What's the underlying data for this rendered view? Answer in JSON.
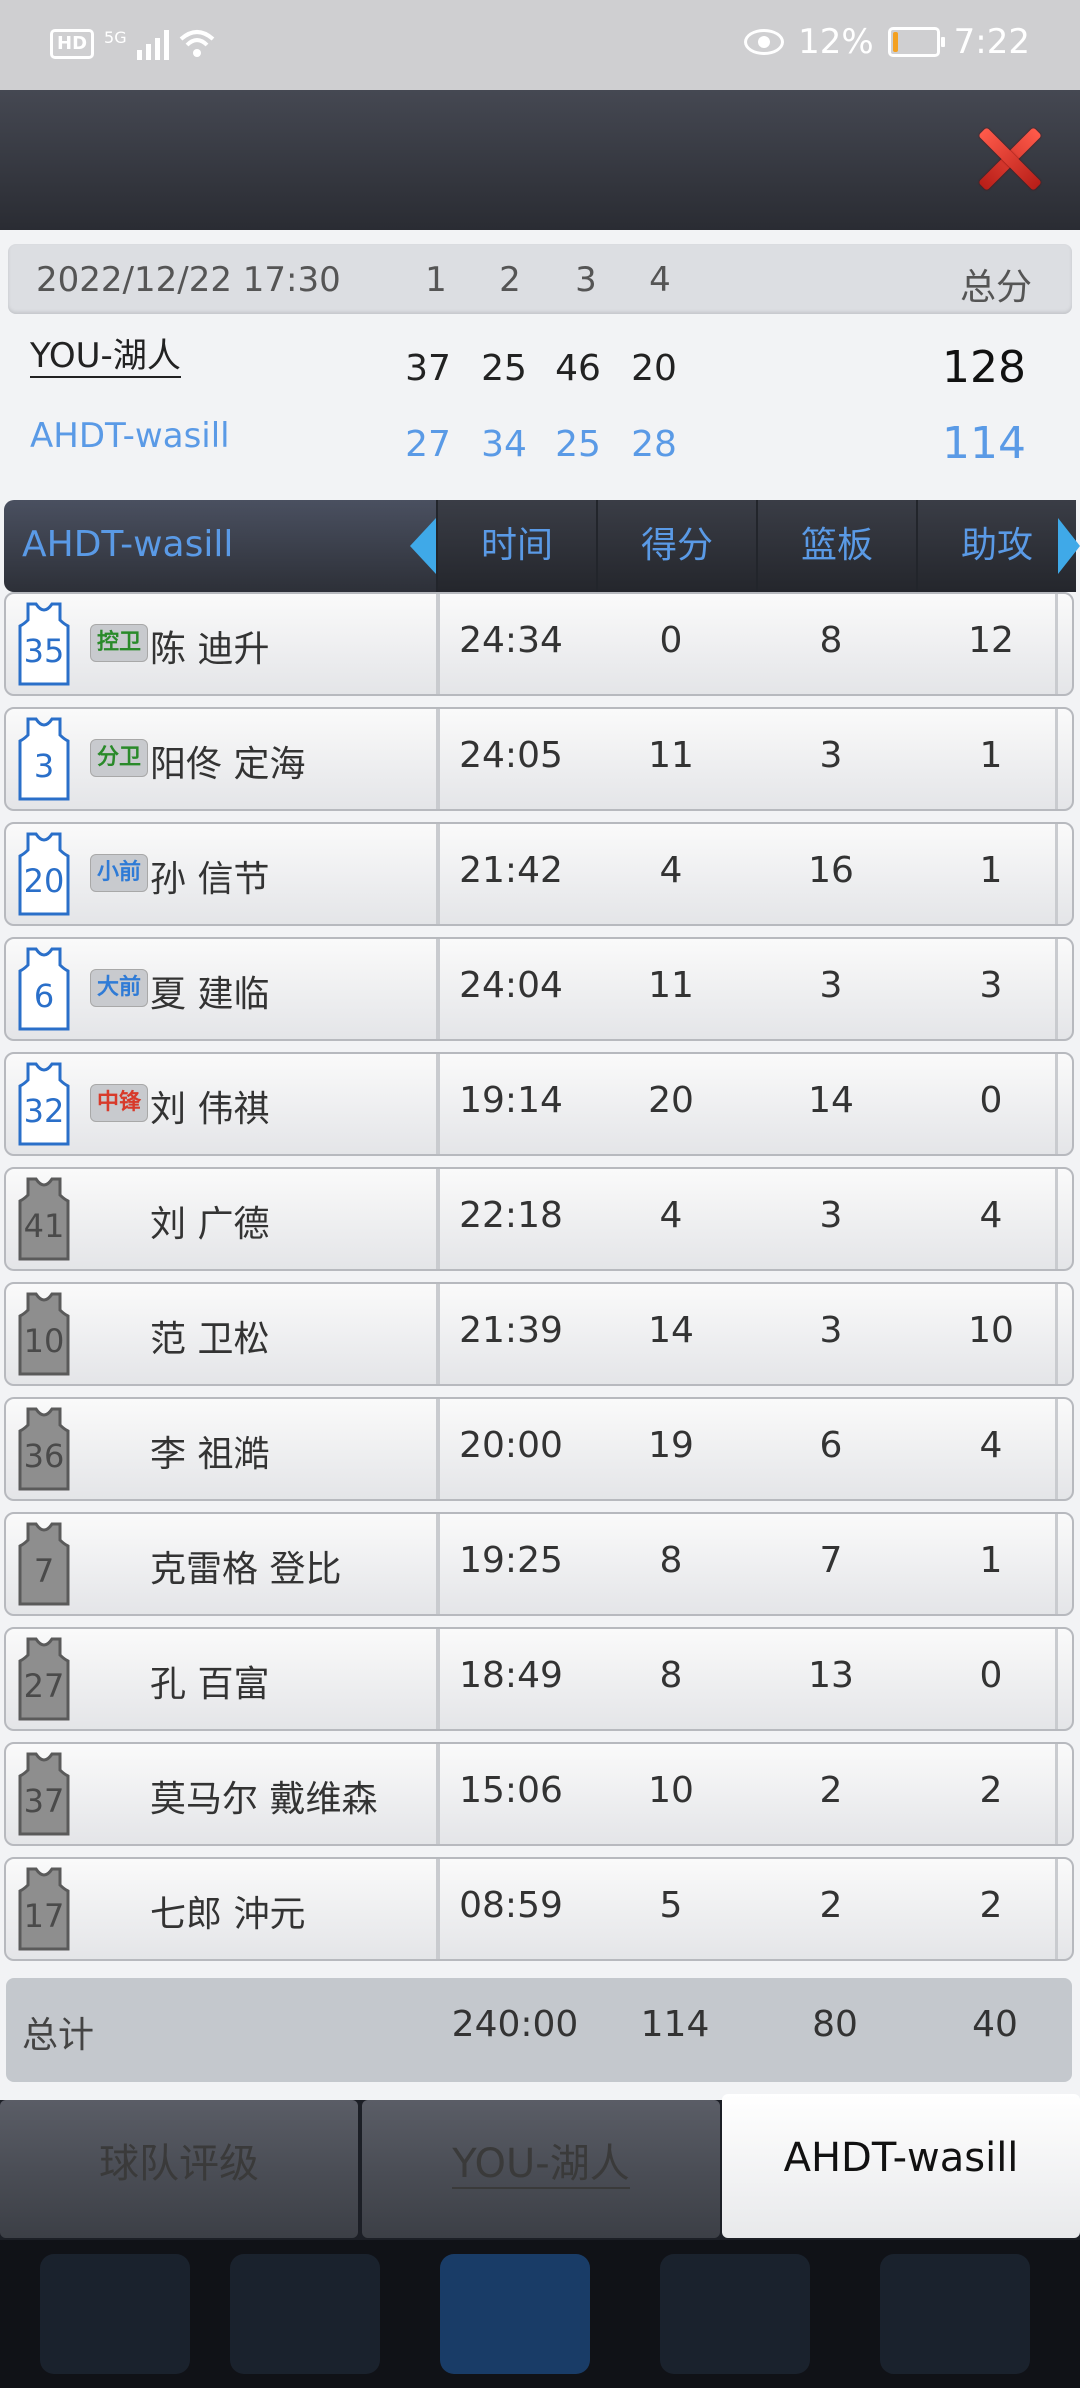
{
  "status": {
    "network": "5G",
    "battery": "12%",
    "battery_level": 0.12,
    "time": "7:22"
  },
  "score": {
    "date": "2022/12/22 17:30",
    "quarters": [
      "1",
      "2",
      "3",
      "4"
    ],
    "total_label": "总分",
    "teams": [
      {
        "name": "YOU-湖人",
        "scores": [
          "37",
          "25",
          "46",
          "20"
        ],
        "total": "128",
        "color": "#222222"
      },
      {
        "name": "AHDT-wasill",
        "scores": [
          "27",
          "34",
          "25",
          "28"
        ],
        "total": "114",
        "color": "#5a9ae6"
      }
    ]
  },
  "table": {
    "team": "AHDT-wasill",
    "columns": [
      "时间",
      "得分",
      "篮板",
      "助攻"
    ],
    "players": [
      {
        "number": "35",
        "pos": "控卫",
        "pos_color": "#2a8a2a",
        "name": "陈 迪升",
        "time": "24:34",
        "pts": "0",
        "reb": "8",
        "ast": "12",
        "starter": true
      },
      {
        "number": "3",
        "pos": "分卫",
        "pos_color": "#2a8a2a",
        "name": "阳佟 定海",
        "time": "24:05",
        "pts": "11",
        "reb": "3",
        "ast": "1",
        "starter": true
      },
      {
        "number": "20",
        "pos": "小前",
        "pos_color": "#2f7bd6",
        "name": "孙 信节",
        "time": "21:42",
        "pts": "4",
        "reb": "16",
        "ast": "1",
        "starter": true
      },
      {
        "number": "6",
        "pos": "大前",
        "pos_color": "#2f7bd6",
        "name": "夏 建临",
        "time": "24:04",
        "pts": "11",
        "reb": "3",
        "ast": "3",
        "starter": true
      },
      {
        "number": "32",
        "pos": "中锋",
        "pos_color": "#d83a2a",
        "name": "刘 伟祺",
        "time": "19:14",
        "pts": "20",
        "reb": "14",
        "ast": "0",
        "starter": true
      },
      {
        "number": "41",
        "pos": "",
        "name": "刘 广德",
        "time": "22:18",
        "pts": "4",
        "reb": "3",
        "ast": "4",
        "starter": false
      },
      {
        "number": "10",
        "pos": "",
        "name": "范 卫松",
        "time": "21:39",
        "pts": "14",
        "reb": "3",
        "ast": "10",
        "starter": false
      },
      {
        "number": "36",
        "pos": "",
        "name": "李 祖澔",
        "time": "20:00",
        "pts": "19",
        "reb": "6",
        "ast": "4",
        "starter": false
      },
      {
        "number": "7",
        "pos": "",
        "name": "克雷格 登比",
        "time": "19:25",
        "pts": "8",
        "reb": "7",
        "ast": "1",
        "starter": false
      },
      {
        "number": "27",
        "pos": "",
        "name": "孔 百富",
        "time": "18:49",
        "pts": "8",
        "reb": "13",
        "ast": "0",
        "starter": false
      },
      {
        "number": "37",
        "pos": "",
        "name": "莫马尔 戴维森",
        "time": "15:06",
        "pts": "10",
        "reb": "2",
        "ast": "2",
        "starter": false
      },
      {
        "number": "17",
        "pos": "",
        "name": "七郎 沖元",
        "time": "08:59",
        "pts": "5",
        "reb": "2",
        "ast": "2",
        "starter": false
      }
    ],
    "totals": {
      "label": "总计",
      "time": "240:00",
      "pts": "114",
      "reb": "80",
      "ast": "40"
    }
  },
  "tabs": [
    "球队评级",
    "YOU-湖人",
    "AHDT-wasill"
  ],
  "active_tab": 2
}
